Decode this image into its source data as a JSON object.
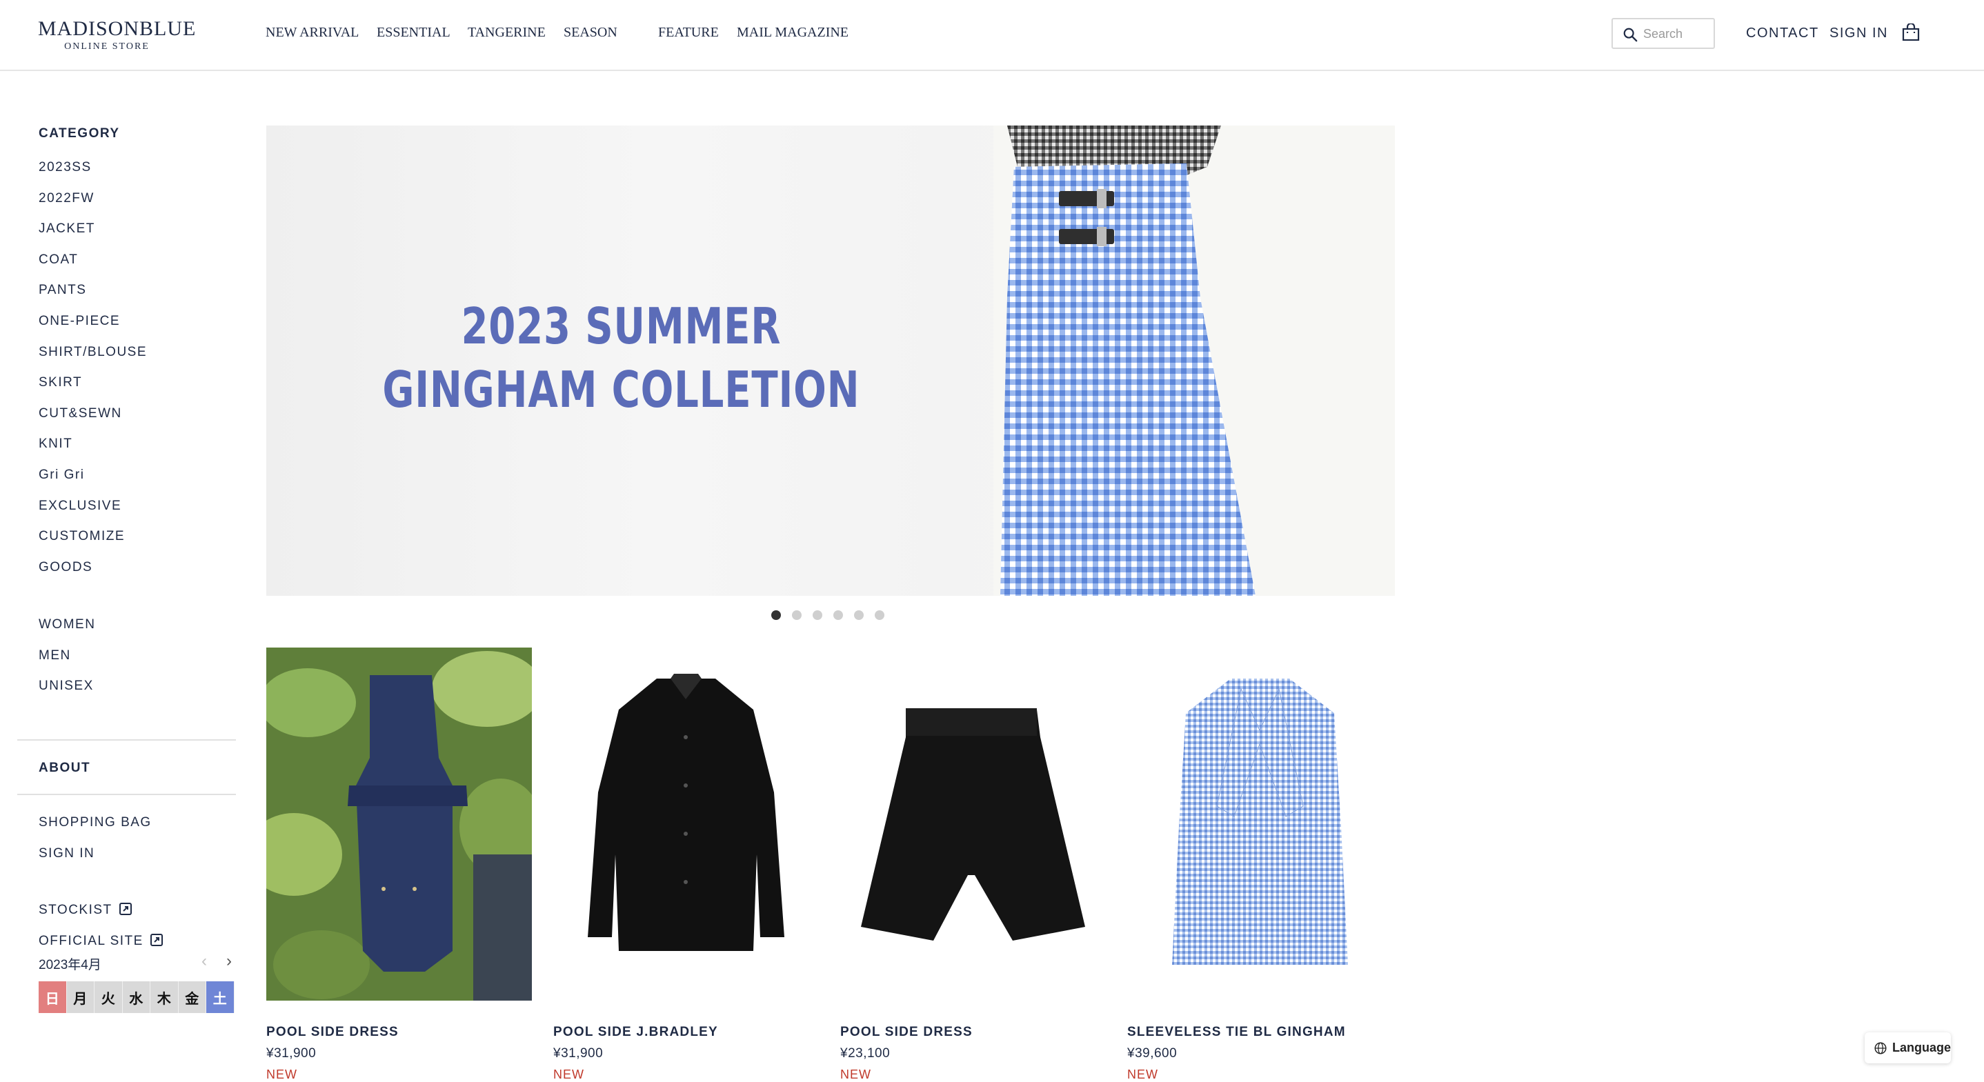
{
  "header": {
    "logo_main": "MADISONBLUE",
    "logo_sub": "ONLINE STORE",
    "nav": [
      "NEW ARRIVAL",
      "ESSENTIAL",
      "TANGERINE",
      "SEASON",
      "FEATURE",
      "MAIL MAGAZINE"
    ],
    "search_placeholder": "Search",
    "contact": "CONTACT",
    "sign_in": "SIGN IN",
    "bag_icon": "shopping-bag-icon"
  },
  "sidebar": {
    "category_heading": "CATEGORY",
    "categories": [
      "2023SS",
      "2022FW",
      "JACKET",
      "COAT",
      "PANTS",
      "ONE-PIECE",
      "SHIRT/BLOUSE",
      "SKIRT",
      "CUT&SEWN",
      "KNIT",
      "Gri Gri",
      "EXCLUSIVE",
      "CUSTOMIZE",
      "GOODS"
    ],
    "genders": [
      "WOMEN",
      "MEN",
      "UNISEX"
    ],
    "about": "ABOUT",
    "account_links": [
      "SHOPPING BAG",
      "SIGN IN"
    ],
    "external_links": [
      "STOCKIST",
      "OFFICIAL SITE"
    ],
    "calendar": {
      "title": "2023年4月",
      "weekdays": [
        "日",
        "月",
        "火",
        "水",
        "木",
        "金",
        "土"
      ]
    }
  },
  "hero": {
    "line1": "2023 SUMMER",
    "line2": "GINGHAM COLLETION",
    "slide_count": 6,
    "active_slide": 1,
    "title_color": "#5b6cb8"
  },
  "products": [
    {
      "name": "POOL SIDE DRESS",
      "price": "¥31,900",
      "badge": "NEW"
    },
    {
      "name": "POOL SIDE J.BRADLEY",
      "price": "¥31,900",
      "badge": "NEW"
    },
    {
      "name": "POOL SIDE DRESS",
      "price": "¥23,100",
      "badge": "NEW"
    },
    {
      "name": "SLEEVELESS TIE BL GINGHAM",
      "price": "¥39,600",
      "badge": "NEW"
    }
  ],
  "language_button": "Language",
  "colors": {
    "text": "#1f2a44",
    "badge": "#c0392b",
    "gingham": "#7ea3e6"
  }
}
